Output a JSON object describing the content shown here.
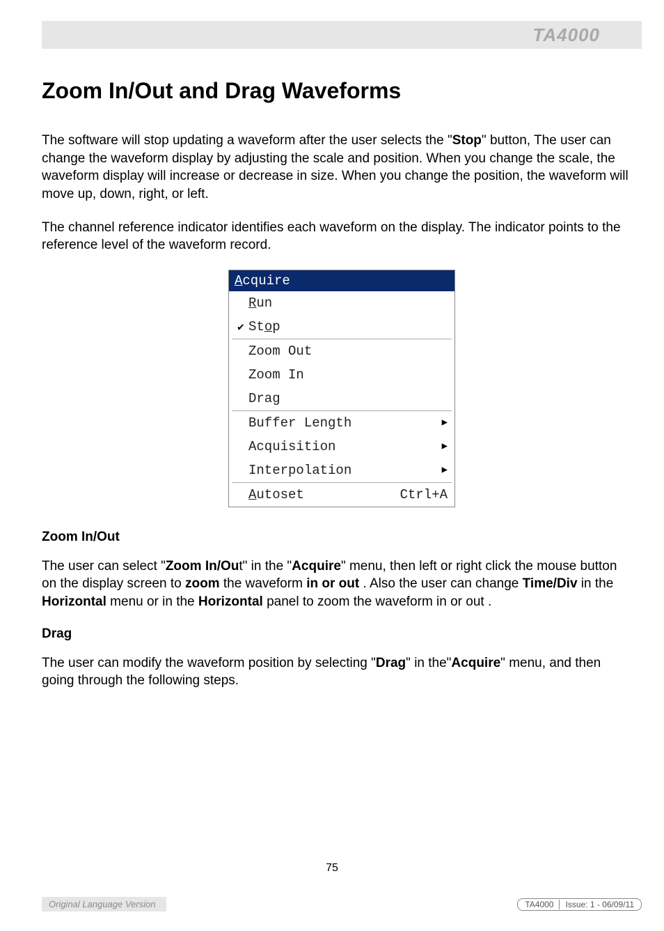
{
  "header": {
    "product": "TA4000"
  },
  "title": "Zoom In/Out and Drag Waveforms",
  "p1_a": "The software will stop updating a waveform after the user selects the \"",
  "p1_stop": "Stop",
  "p1_b": "\" button, The user can change the waveform display by adjusting the scale and position. When you change the scale, the waveform display will increase or decrease in size. When you change the position, the waveform will move up, down, right, or left.",
  "p2": "The channel reference indicator identifies each waveform on the display. The indicator points to the reference level of the waveform record.",
  "menu": {
    "title_pre": "A",
    "title_rest": "cquire",
    "items": [
      {
        "check": "",
        "pre": "",
        "ul": "R",
        "post": "un",
        "arrow": false,
        "shortcut": ""
      },
      {
        "check": "✔",
        "pre": "St",
        "ul": "o",
        "post": "p",
        "arrow": false,
        "shortcut": ""
      }
    ],
    "items2": [
      {
        "check": "",
        "pre": "Zoom Out",
        "ul": "",
        "post": "",
        "arrow": false,
        "shortcut": ""
      },
      {
        "check": "",
        "pre": "Zoom In",
        "ul": "",
        "post": "",
        "arrow": false,
        "shortcut": ""
      },
      {
        "check": "",
        "pre": "Drag",
        "ul": "",
        "post": "",
        "arrow": false,
        "shortcut": ""
      }
    ],
    "items3": [
      {
        "check": "",
        "pre": "Buffer Length",
        "ul": "",
        "post": "",
        "arrow": true,
        "shortcut": ""
      },
      {
        "check": "",
        "pre": "Acquisition",
        "ul": "",
        "post": "",
        "arrow": true,
        "shortcut": ""
      },
      {
        "check": "",
        "pre": "Interpolation",
        "ul": "",
        "post": "",
        "arrow": true,
        "shortcut": ""
      }
    ],
    "items4": [
      {
        "check": "",
        "pre": "",
        "ul": "A",
        "post": "utoset",
        "arrow": false,
        "shortcut": "Ctrl+A"
      }
    ]
  },
  "sec1_h": "Zoom In/Out",
  "sec1_a": "The user can select \"",
  "sec1_b": "Zoom In/Ou",
  "sec1_c": "t\" in the \"",
  "sec1_d": "Acquire",
  "sec1_e": "\" menu, then left or right click the mouse button on the display screen to ",
  "sec1_f": "zoom",
  "sec1_g": " the waveform ",
  "sec1_h2": "in or out",
  "sec1_i": " . Also the user can change ",
  "sec1_j": "Time/Div",
  "sec1_k": " in the ",
  "sec1_l": "Horizontal",
  "sec1_m": " menu or in the ",
  "sec1_n": "Horizontal",
  "sec1_o": " panel to zoom the waveform in or out .",
  "sec2_h": "Drag",
  "sec2_a": "The user can modify the waveform  position by selecting \"",
  "sec2_b": "Drag",
  "sec2_c": "\" in the\"",
  "sec2_d": "Acquire",
  "sec2_e": "\" menu, and then going through the following steps.",
  "footer": {
    "page": "75",
    "left": "Original Language Version",
    "right_a": "TA4000",
    "right_b": "Issue: 1 - 06/09/11"
  }
}
